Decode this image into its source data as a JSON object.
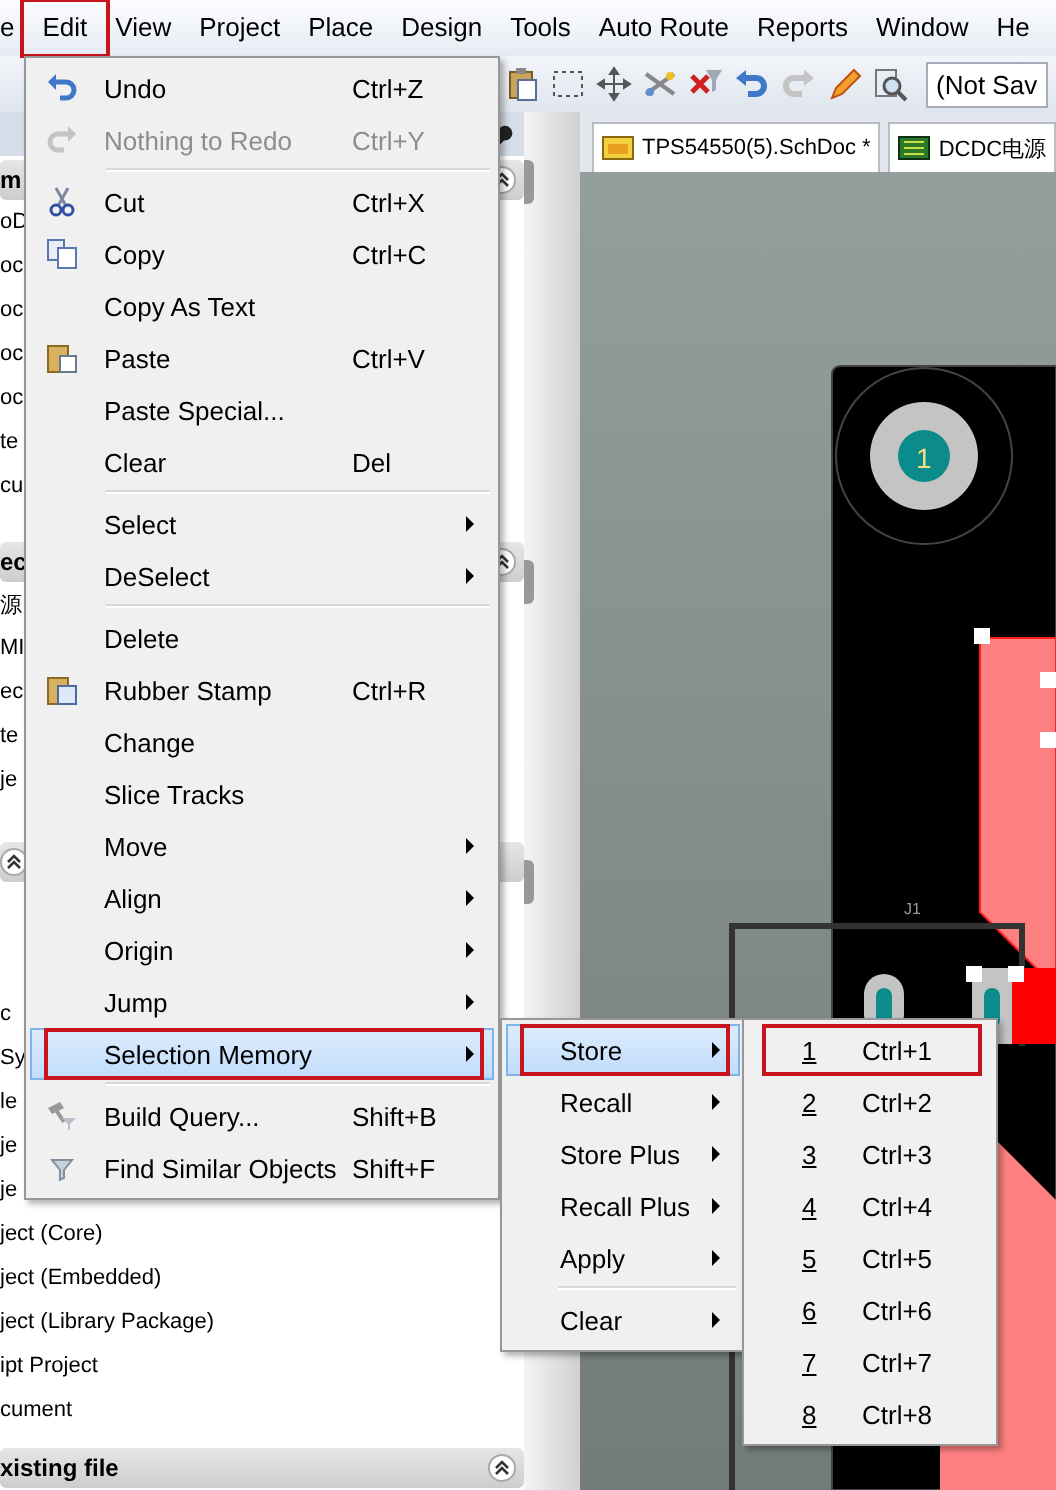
{
  "menu_bar": [
    {
      "label": "e",
      "marked": false
    },
    {
      "label": "Edit",
      "marked": true
    },
    {
      "label": "View",
      "marked": false
    },
    {
      "label": "Project",
      "marked": false
    },
    {
      "label": "Place",
      "marked": false
    },
    {
      "label": "Design",
      "marked": false
    },
    {
      "label": "Tools",
      "marked": false
    },
    {
      "label": "Auto Route",
      "marked": false
    },
    {
      "label": "Reports",
      "marked": false
    },
    {
      "label": "Window",
      "marked": false
    },
    {
      "label": "He",
      "marked": false
    }
  ],
  "toolbar": {
    "combo_value": "(Not Sav"
  },
  "panel": {
    "sections": [
      {
        "header": "m",
        "rows": [
          "oD",
          "oc",
          "oc",
          "oc",
          "oc",
          "te",
          "cu"
        ]
      },
      {
        "header": "ec",
        "rows": [
          "源",
          "MI",
          "ec",
          "te",
          "je"
        ]
      },
      {
        "rows": [
          "c",
          "Sy",
          "le",
          "je",
          "je",
          "ject (Core)",
          "ject (Embedded)",
          "ject (Library Package)",
          "ipt Project",
          "cument"
        ]
      },
      {
        "header": "xisting file"
      }
    ]
  },
  "document_tabs": [
    {
      "label": "TPS54550(5).SchDoc *"
    },
    {
      "label": "DCDC电源"
    }
  ],
  "board": {
    "pad_number": "1",
    "designator": "J1"
  },
  "edit_menu": [
    {
      "kind": "item",
      "label": "Undo",
      "shortcut": "Ctrl+Z",
      "submenu": false,
      "disabled": false,
      "selected": false,
      "marked": false
    },
    {
      "kind": "item",
      "label": "Nothing to Redo",
      "shortcut": "Ctrl+Y",
      "submenu": false,
      "disabled": true,
      "selected": false,
      "marked": false
    },
    {
      "kind": "separator"
    },
    {
      "kind": "item",
      "label": "Cut",
      "shortcut": "Ctrl+X",
      "submenu": false,
      "disabled": false,
      "selected": false,
      "marked": false
    },
    {
      "kind": "item",
      "label": "Copy",
      "shortcut": "Ctrl+C",
      "submenu": false,
      "disabled": false,
      "selected": false,
      "marked": false
    },
    {
      "kind": "item",
      "label": "Copy As Text",
      "submenu": false,
      "disabled": false,
      "selected": false,
      "marked": false
    },
    {
      "kind": "item",
      "label": "Paste",
      "shortcut": "Ctrl+V",
      "submenu": false,
      "disabled": false,
      "selected": false,
      "marked": false
    },
    {
      "kind": "item",
      "label": "Paste Special...",
      "submenu": false,
      "disabled": false,
      "selected": false,
      "marked": false
    },
    {
      "kind": "item",
      "label": "Clear",
      "shortcut": "Del",
      "submenu": false,
      "disabled": false,
      "selected": false,
      "marked": false
    },
    {
      "kind": "separator"
    },
    {
      "kind": "item",
      "label": "Select",
      "submenu": true,
      "disabled": false,
      "selected": false,
      "marked": false
    },
    {
      "kind": "item",
      "label": "DeSelect",
      "submenu": true,
      "disabled": false,
      "selected": false,
      "marked": false
    },
    {
      "kind": "separator"
    },
    {
      "kind": "item",
      "label": "Delete",
      "submenu": false,
      "disabled": false,
      "selected": false,
      "marked": false
    },
    {
      "kind": "item",
      "label": "Rubber Stamp",
      "shortcut": "Ctrl+R",
      "submenu": false,
      "disabled": false,
      "selected": false,
      "marked": false
    },
    {
      "kind": "item",
      "label": "Change",
      "submenu": false,
      "disabled": false,
      "selected": false,
      "marked": false
    },
    {
      "kind": "item",
      "label": "Slice Tracks",
      "submenu": false,
      "disabled": false,
      "selected": false,
      "marked": false
    },
    {
      "kind": "item",
      "label": "Move",
      "submenu": true,
      "disabled": false,
      "selected": false,
      "marked": false
    },
    {
      "kind": "item",
      "label": "Align",
      "submenu": true,
      "disabled": false,
      "selected": false,
      "marked": false
    },
    {
      "kind": "item",
      "label": "Origin",
      "submenu": true,
      "disabled": false,
      "selected": false,
      "marked": false
    },
    {
      "kind": "item",
      "label": "Jump",
      "submenu": true,
      "disabled": false,
      "selected": false,
      "marked": false
    },
    {
      "kind": "item",
      "label": "Selection Memory",
      "submenu": true,
      "disabled": false,
      "selected": true,
      "marked": true
    },
    {
      "kind": "separator"
    },
    {
      "kind": "item",
      "label": "Build Query...",
      "shortcut": "Shift+B",
      "submenu": false,
      "disabled": false,
      "selected": false,
      "marked": false
    },
    {
      "kind": "item",
      "label": "Find Similar Objects",
      "shortcut": "Shift+F",
      "submenu": false,
      "disabled": false,
      "selected": false,
      "marked": false
    }
  ],
  "memory_menu": [
    {
      "kind": "item",
      "label": "Store",
      "submenu": true,
      "disabled": false,
      "selected": true,
      "marked": true
    },
    {
      "kind": "item",
      "label": "Recall",
      "submenu": true,
      "disabled": false,
      "selected": false,
      "marked": false
    },
    {
      "kind": "item",
      "label": "Store Plus",
      "submenu": true,
      "disabled": false,
      "selected": false,
      "marked": false
    },
    {
      "kind": "item",
      "label": "Recall Plus",
      "submenu": true,
      "disabled": false,
      "selected": false,
      "marked": false
    },
    {
      "kind": "item",
      "label": "Apply",
      "submenu": true,
      "disabled": false,
      "selected": false,
      "marked": false
    },
    {
      "kind": "separator"
    },
    {
      "kind": "item",
      "label": "Clear",
      "submenu": true,
      "disabled": false,
      "selected": false,
      "marked": false
    }
  ],
  "store_menu": [
    {
      "key": "1",
      "shortcut": "Ctrl+1",
      "marked": true
    },
    {
      "key": "2",
      "shortcut": "Ctrl+2",
      "marked": false
    },
    {
      "key": "3",
      "shortcut": "Ctrl+3",
      "marked": false
    },
    {
      "key": "4",
      "shortcut": "Ctrl+4",
      "marked": false
    },
    {
      "key": "5",
      "shortcut": "Ctrl+5",
      "marked": false
    },
    {
      "key": "6",
      "shortcut": "Ctrl+6",
      "marked": false
    },
    {
      "key": "7",
      "shortcut": "Ctrl+7",
      "marked": false
    },
    {
      "key": "8",
      "shortcut": "Ctrl+8",
      "marked": false
    }
  ]
}
